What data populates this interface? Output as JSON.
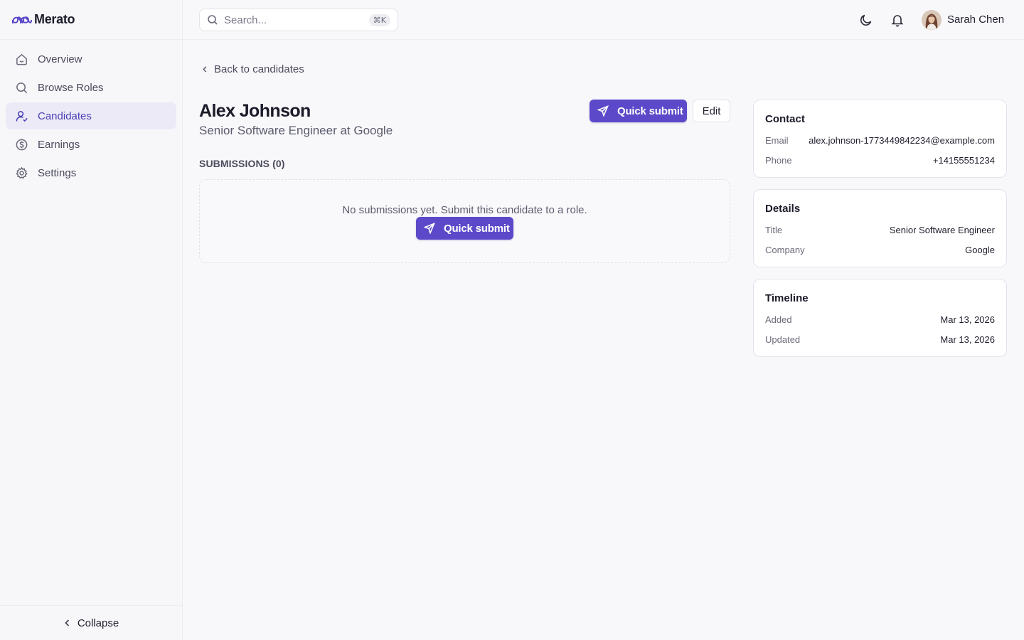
{
  "brand": {
    "name": "Merato",
    "accent": "#5b49c9"
  },
  "sidebar": {
    "items": [
      {
        "label": "Overview",
        "icon": "home-icon",
        "active": false
      },
      {
        "label": "Browse Roles",
        "icon": "search-icon",
        "active": false
      },
      {
        "label": "Candidates",
        "icon": "user-icon",
        "active": true
      },
      {
        "label": "Earnings",
        "icon": "dollar-icon",
        "active": false
      },
      {
        "label": "Settings",
        "icon": "gear-icon",
        "active": false
      }
    ],
    "collapse_label": "Collapse"
  },
  "topbar": {
    "search_placeholder": "Search...",
    "search_shortcut": "⌘K",
    "user_name": "Sarah Chen"
  },
  "main": {
    "back_label": "Back to candidates",
    "candidate_name": "Alex Johnson",
    "candidate_subtitle": "Senior Software Engineer at Google",
    "quick_submit_label": "Quick submit",
    "edit_label": "Edit",
    "submissions_label": "SUBMISSIONS (0)",
    "empty_message": "No submissions yet. Submit this candidate to a role.",
    "empty_quick_submit_label": "Quick submit"
  },
  "cards": {
    "contact": {
      "title": "Contact",
      "email_label": "Email",
      "email_value": "alex.johnson-1773449842234@example.com",
      "phone_label": "Phone",
      "phone_value": "+14155551234"
    },
    "details": {
      "title": "Details",
      "title_label": "Title",
      "title_value": "Senior Software Engineer",
      "company_label": "Company",
      "company_value": "Google"
    },
    "timeline": {
      "title": "Timeline",
      "added_label": "Added",
      "added_value": "Mar 13, 2026",
      "updated_label": "Updated",
      "updated_value": "Mar 13, 2026"
    }
  }
}
